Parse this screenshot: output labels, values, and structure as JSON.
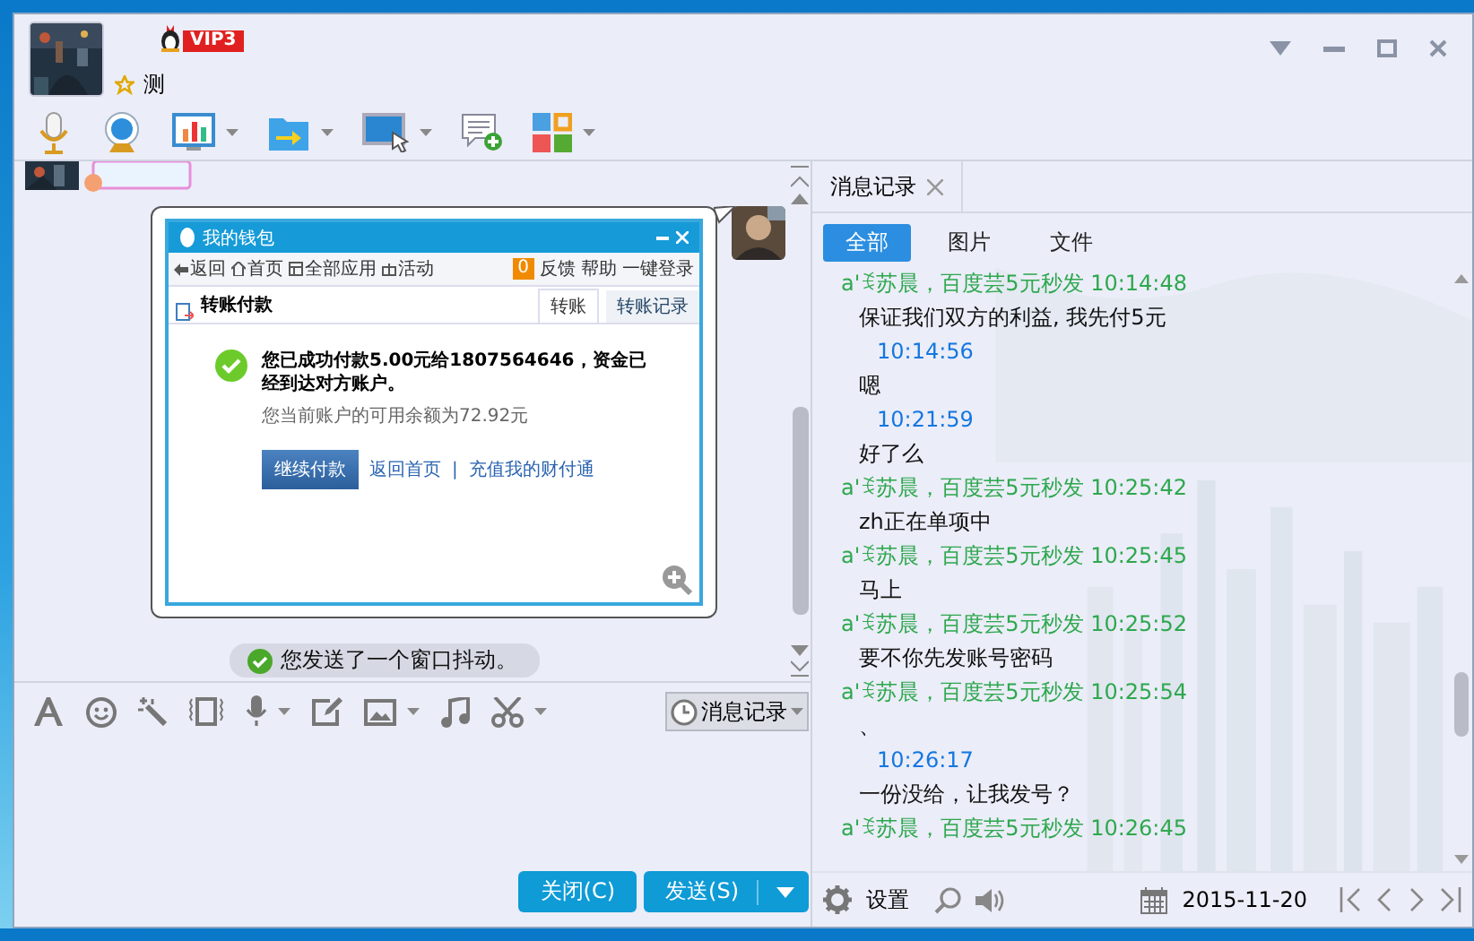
{
  "profile": {
    "vip_badge": "VIP3",
    "name": "测"
  },
  "chat": {
    "shared_screenshot": {
      "title": "我的钱包",
      "nav": [
        {
          "label": "返回",
          "kind": "back"
        },
        {
          "label": "首页",
          "kind": "home"
        },
        {
          "label": "全部应用",
          "kind": "apps"
        },
        {
          "label": "活动",
          "kind": "event"
        }
      ],
      "badge": "0",
      "links": [
        "反馈",
        "帮助",
        "一键登录"
      ],
      "heading": "转账付款",
      "tabs": [
        {
          "label": "转账",
          "selected": true
        },
        {
          "label": "转账记录",
          "selected": false
        }
      ],
      "message": "您已成功付款5.00元给1807564646，资金已经到达对方账户。",
      "balance": "您当前账户的可用余额为72.92元",
      "button": "继续付款",
      "actions": [
        "返回首页",
        "|",
        "充值我的财付通"
      ]
    },
    "notice": "您发送了一个窗口抖动。"
  },
  "input_toolbar": {
    "history_button": "消息记录"
  },
  "buttons": [
    {
      "label": "关闭(C)",
      "kind": "plain"
    },
    {
      "label": "发送(S)",
      "kind": "split"
    }
  ],
  "history": {
    "tab": "消息记录",
    "filters": [
      {
        "label": "全部",
        "selected": true
      },
      {
        "label": "图片",
        "selected": false
      },
      {
        "label": "文件",
        "selected": false
      }
    ],
    "messages": [
      {
        "kind": "peer",
        "sender": "a'ꉂ苏晨，百度芸5元秒发",
        "time": "10:14:48",
        "text": "保证我们双方的利益, 我先付5元"
      },
      {
        "kind": "self",
        "time": "10:14:56",
        "text": "嗯"
      },
      {
        "kind": "self",
        "time": "10:21:59",
        "text": "好了么"
      },
      {
        "kind": "peer",
        "sender": "a'ꉂ苏晨，百度芸5元秒发",
        "time": "10:25:42",
        "text": "zh正在单项中"
      },
      {
        "kind": "peer",
        "sender": "a'ꉂ苏晨，百度芸5元秒发",
        "time": "10:25:45",
        "text": "马上"
      },
      {
        "kind": "peer",
        "sender": "a'ꉂ苏晨，百度芸5元秒发",
        "time": "10:25:52",
        "text": "要不你先发账号密码"
      },
      {
        "kind": "peer",
        "sender": "a'ꉂ苏晨，百度芸5元秒发",
        "time": "10:25:54",
        "text": "、"
      },
      {
        "kind": "self",
        "time": "10:26:17",
        "text": "一份没给，让我发号？"
      },
      {
        "kind": "peer",
        "sender": "a'ꉂ苏晨，百度芸5元秒发",
        "time": "10:26:45"
      }
    ],
    "settings": "设置",
    "date": "2015-11-20"
  }
}
